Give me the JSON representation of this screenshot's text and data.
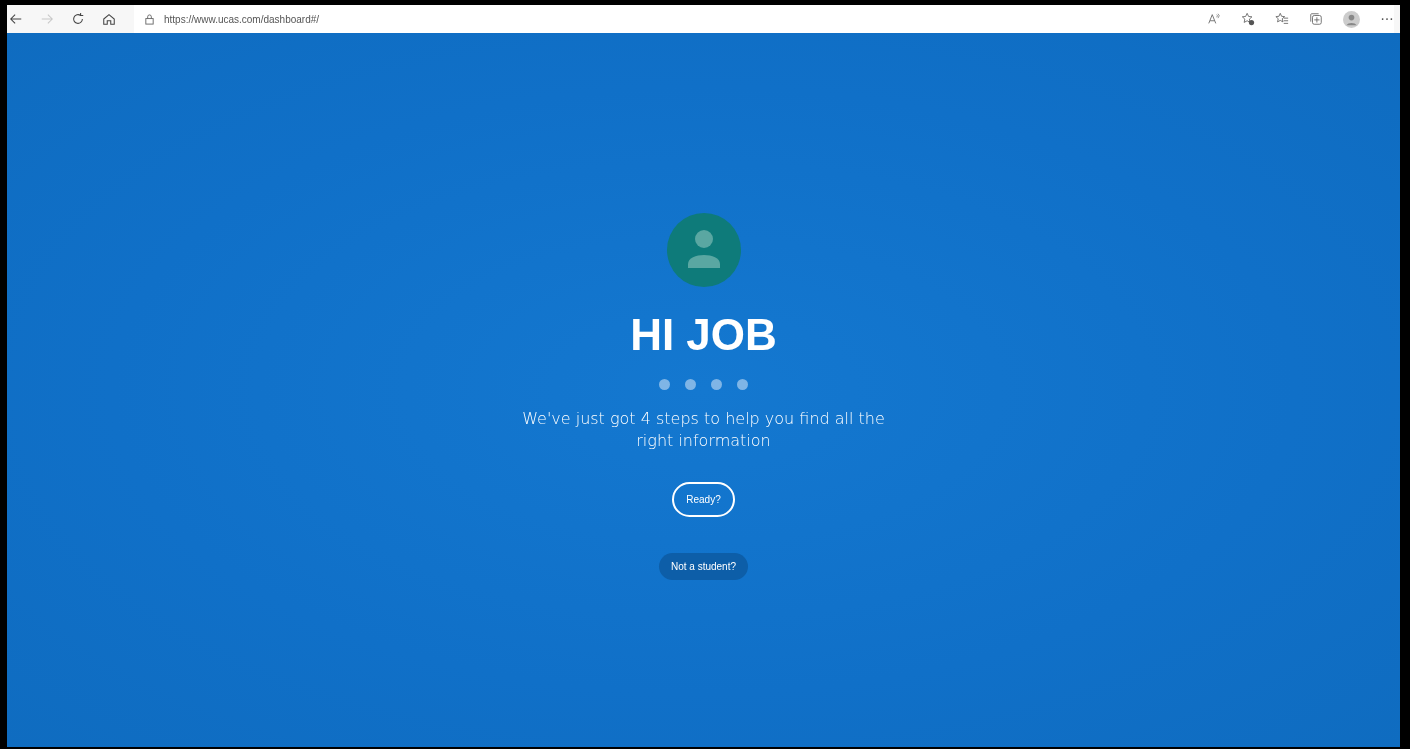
{
  "browser": {
    "url": "https://www.ucas.com/dashboard#/",
    "back_disabled": false,
    "forward_disabled": true
  },
  "greeting": {
    "title": "HI JOB",
    "steps": [
      {
        "selected": false
      },
      {
        "selected": false
      },
      {
        "selected": false
      },
      {
        "selected": false
      }
    ],
    "message": "We've just got 4 steps to help you find all the right information",
    "buttons": [
      {
        "kind": "outline",
        "label": "Ready?"
      },
      {
        "kind": "filled",
        "label": "Not a student?"
      }
    ]
  }
}
